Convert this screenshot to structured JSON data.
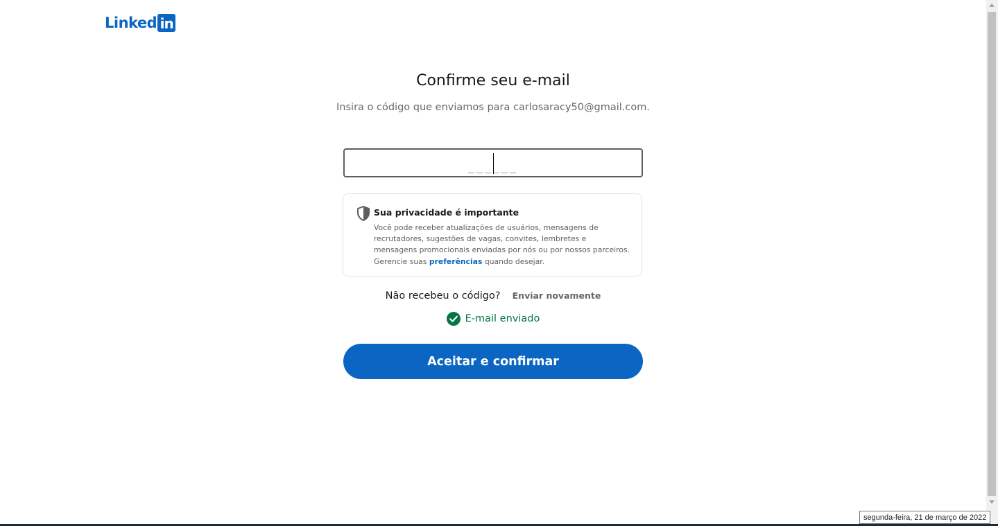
{
  "header": {
    "logo_word": "Linked",
    "logo_box": "in"
  },
  "main": {
    "title": "Confirme seu e-mail",
    "subtitle": "Insira o código que enviamos para carlosaracy50@gmail.com.",
    "code_input": {
      "value": "",
      "placeholder": "______"
    }
  },
  "privacy": {
    "icon": "shield-icon",
    "title": "Sua privacidade é importante",
    "text_before_link": "Você pode receber atualizações de usuários, mensagens de recrutadores, sugestões de vagas, convites, lembretes e mensagens promocionais enviadas por nós ou por nossos parceiros. Gerencie suas ",
    "link_label": "preferências",
    "text_after_link": " quando desejar."
  },
  "resend": {
    "question": "Não recebeu o código?",
    "button_label": "Enviar novamente"
  },
  "status": {
    "icon": "check-circle-icon",
    "text": "E-mail enviado"
  },
  "actions": {
    "accept_label": "Aceitar e confirmar"
  },
  "system": {
    "date_tooltip": "segunda-feira, 21 de março de 2022"
  },
  "colors": {
    "brand": "#0a66c2",
    "success": "#057642",
    "text_primary": "#191919",
    "text_secondary": "#666666"
  }
}
